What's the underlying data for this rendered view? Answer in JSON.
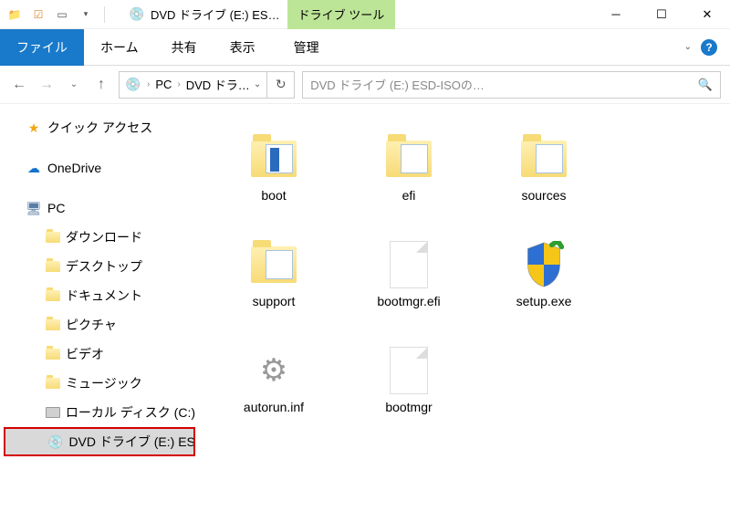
{
  "titlebar": {
    "title": "DVD ドライブ (E:) ES…",
    "context_tab": "ドライブ ツール"
  },
  "ribbon": {
    "file": "ファイル",
    "tabs": [
      "ホーム",
      "共有",
      "表示"
    ],
    "context": "管理"
  },
  "addr": {
    "crumbs": [
      "PC",
      "DVD ドラ…"
    ]
  },
  "search": {
    "placeholder": "DVD ドライブ (E:) ESD-ISOの…"
  },
  "sidebar": {
    "quick_access": "クイック アクセス",
    "onedrive": "OneDrive",
    "pc": "PC",
    "pc_children": [
      "ダウンロード",
      "デスクトップ",
      "ドキュメント",
      "ピクチャ",
      "ビデオ",
      "ミュージック",
      "ローカル ディスク (C:)",
      "DVD ドライブ (E:) ESD"
    ]
  },
  "files": {
    "items": [
      {
        "name": "boot",
        "type": "folder-doc"
      },
      {
        "name": "efi",
        "type": "folder"
      },
      {
        "name": "sources",
        "type": "folder"
      },
      {
        "name": "support",
        "type": "folder"
      },
      {
        "name": "bootmgr.efi",
        "type": "file"
      },
      {
        "name": "setup.exe",
        "type": "exe"
      },
      {
        "name": "autorun.inf",
        "type": "gear"
      },
      {
        "name": "bootmgr",
        "type": "file"
      }
    ]
  }
}
